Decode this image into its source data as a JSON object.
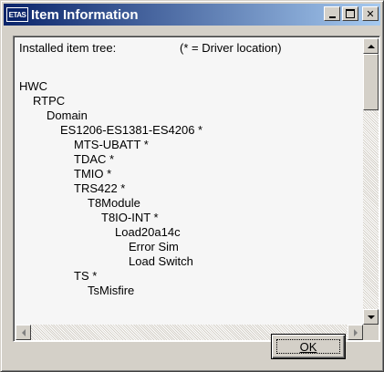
{
  "window": {
    "title": "Item Information",
    "icon_text": "ETAS",
    "icon": "etas-logo-icon",
    "controls": [
      "minimize-icon",
      "maximize-icon",
      "close-icon"
    ]
  },
  "tree": {
    "header": "Installed item tree:",
    "legend": "(* = Driver location)",
    "items": [
      {
        "label": "HWC",
        "level": 0
      },
      {
        "label": "RTPC",
        "level": 1
      },
      {
        "label": "Domain",
        "level": 2
      },
      {
        "label": "ES1206-ES1381-ES4206 *",
        "level": 3
      },
      {
        "label": "MTS-UBATT *",
        "level": 4
      },
      {
        "label": "TDAC *",
        "level": 4
      },
      {
        "label": "TMIO *",
        "level": 4
      },
      {
        "label": "TRS422 *",
        "level": 4
      },
      {
        "label": "T8Module",
        "level": 5
      },
      {
        "label": "T8IO-INT *",
        "level": 6
      },
      {
        "label": "Load20a14c",
        "level": 7
      },
      {
        "label": "Error Sim",
        "level": 8
      },
      {
        "label": "Load Switch",
        "level": 8
      },
      {
        "label": "TS *",
        "level": 4
      },
      {
        "label": "TsMisfire",
        "level": 5
      }
    ]
  },
  "buttons": {
    "ok_label": "OK"
  },
  "colors": {
    "titlebar_start": "#0a246a",
    "titlebar_end": "#a6caf0",
    "face": "#d4d0c8"
  }
}
